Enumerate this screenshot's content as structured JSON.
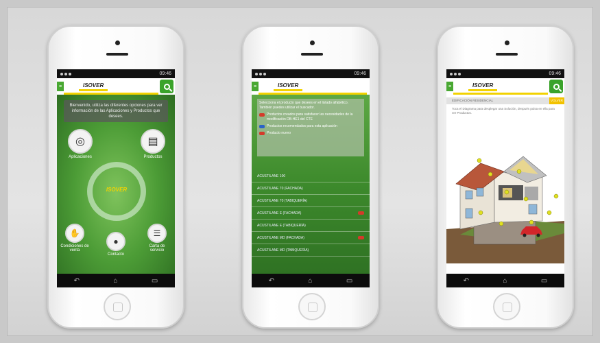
{
  "phones": [
    {
      "status": {
        "time": "09:46"
      },
      "header": {
        "logo": "ISOVER"
      },
      "banner": "Bienvenido, utiliza las diferentes opciones para ver información de las Aplicaciones y Productos que desees.",
      "menu": {
        "aplicaciones": "Aplicaciones",
        "productos": "Productos",
        "condiciones": "Condiciones de venta",
        "contacto": "Contacto",
        "carta": "Carta de servicio"
      },
      "center_logo": "ISOVER"
    },
    {
      "status": {
        "time": "09:46"
      },
      "header": {
        "logo": "ISOVER"
      },
      "intro": "Selecciona el producto que desees en el listado alfabético. También puedes utilizar el buscador.",
      "legend": [
        {
          "text": "Productos creados para satisfacer las necesidades de la modificación DB-HE1 del CTE",
          "color": "#d43a2a"
        },
        {
          "text": "Productos recomendados para esta aplicación",
          "color": "#2a62c8"
        },
        {
          "text": "Producto nuevo",
          "color": "#d43a2a"
        }
      ],
      "list": [
        {
          "label": "ACUSTILANE 100",
          "tag": false
        },
        {
          "label": "ACUSTILANE 70 (FACHADA)",
          "tag": false
        },
        {
          "label": "ACUSTILANE 70 (TABIQUERÍA)",
          "tag": false
        },
        {
          "label": "ACUSTILANE E (FACHADA)",
          "tag": true
        },
        {
          "label": "ACUSTILANE E (TABIQUERÍA)",
          "tag": false
        },
        {
          "label": "ACUSTILANE MD (FACHADA)",
          "tag": true
        },
        {
          "label": "ACUSTILANE MD (TABIQUERÍA)",
          "tag": false
        }
      ]
    },
    {
      "status": {
        "time": "09:46"
      },
      "header": {
        "logo": "ISOVER"
      },
      "topbar": {
        "label": "EDIFICACIÓN RESIDENCIAL",
        "button": "VOLVER"
      },
      "description": "Toca el Diagrama para desplegar una Solución, después pulsa en ella para ver Productos."
    }
  ],
  "colors": {
    "brand_green": "#3aa32a",
    "brand_yellow": "#f2d200"
  }
}
